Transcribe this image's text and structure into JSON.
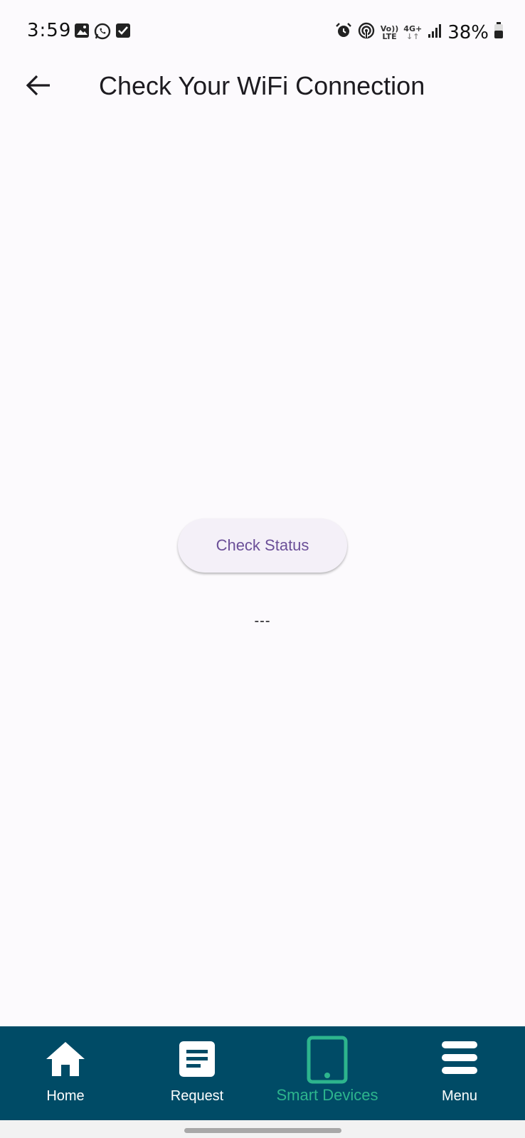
{
  "status_bar": {
    "time": "3:59",
    "left_icons": [
      "gallery-icon",
      "whatsapp-icon",
      "check-square-icon"
    ],
    "right_icons": [
      "alarm-icon",
      "hotspot-icon",
      "volte-icon",
      "4g-data-icon",
      "signal-icon",
      "battery-icon"
    ],
    "volte_top": "Vo))",
    "volte_bottom": "LTE",
    "network_top": "4G+",
    "network_bottom": "↓↑",
    "battery": "38%"
  },
  "app_bar": {
    "title": "Check Your WiFi Connection",
    "back_icon": "arrow-back-icon"
  },
  "main": {
    "check_button_label": "Check Status",
    "result_text": "---"
  },
  "bottom_nav": {
    "items": [
      {
        "label": "Home",
        "icon": "home-icon",
        "active": false
      },
      {
        "label": "Request",
        "icon": "request-icon",
        "active": false
      },
      {
        "label": "Smart Devices",
        "icon": "tablet-icon",
        "active": true
      },
      {
        "label": "Menu",
        "icon": "menu-icon",
        "active": false
      }
    ]
  },
  "colors": {
    "background": "#FCFAFD",
    "nav_background": "#004B66",
    "nav_active": "#2DB58D",
    "button_text": "#6B4F98",
    "button_background": "#F4F0F8"
  }
}
